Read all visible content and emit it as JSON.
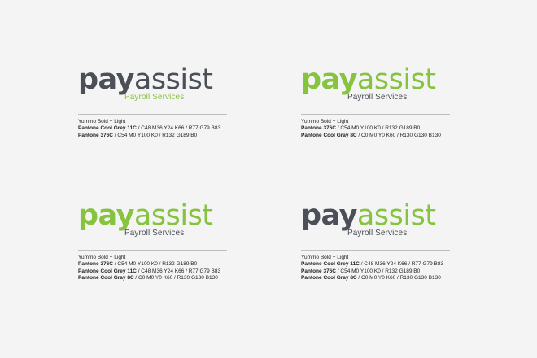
{
  "colors": {
    "grey": "#4b4f57",
    "green": "#86c33f",
    "background": "#f4f4f4"
  },
  "variants": [
    {
      "pay_color": "grey",
      "assist_color": "grey",
      "tagline_color": "green",
      "wordmark": {
        "pay": "pay",
        "assist": "assist"
      },
      "tagline": "Payroll Services",
      "typeface": "Yummo Bold + Light",
      "swatches": [
        {
          "name": "Pantone Cool Grey 11C",
          "values": " / C48 M36 Y24 K66 / R77 G79 B83"
        },
        {
          "name": "Pantone 376C",
          "values": " / C54 M0 Y100 K0 / R132 G189 B0"
        }
      ]
    },
    {
      "pay_color": "green",
      "assist_color": "green",
      "tagline_color": "grey",
      "wordmark": {
        "pay": "pay",
        "assist": "assist"
      },
      "tagline": "Payroll Services",
      "typeface": "Yummo Bold + Light",
      "swatches": [
        {
          "name": "Pantone 376C",
          "values": " / C54 M0 Y100 K0 / R132 G189 B0"
        },
        {
          "name": "Pantone Cool Gray 8C",
          "values": " / C0 M0 Y0 K60 / R130 G130 B130"
        }
      ]
    },
    {
      "pay_color": "green",
      "assist_color": "green",
      "tagline_color": "grey",
      "wordmark": {
        "pay": "pay",
        "assist": "assist"
      },
      "tagline": "Payroll Services",
      "typeface": "Yummo Bold + Light",
      "swatches": [
        {
          "name": "Pantone 376C",
          "values": " / C54 M0 Y100 K0 / R132 G189 B0"
        },
        {
          "name": "Pantone Cool Grey 11C",
          "values": " / C48 M36 Y24 K66 / R77 G79 B83"
        },
        {
          "name": "Pantone Cool Gray 8C",
          "values": " / C0 M0 Y0 K60 / R130 G130 B130"
        }
      ]
    },
    {
      "pay_color": "grey",
      "assist_color": "green",
      "tagline_color": "grey",
      "wordmark": {
        "pay": "pay",
        "assist": "assist"
      },
      "tagline": "Payroll Services",
      "typeface": "Yummo Bold + Light",
      "swatches": [
        {
          "name": "Pantone Cool Grey 11C",
          "values": " / C48 M36 Y24 K66 / R77 G79 B83"
        },
        {
          "name": "Pantone 376C",
          "values": " / C54 M0 Y100 K0 / R132 G189 B0"
        },
        {
          "name": "Pantone Cool Gray 8C",
          "values": " / C0 M0 Y0 K60 / R130 G130 B130"
        }
      ]
    }
  ]
}
